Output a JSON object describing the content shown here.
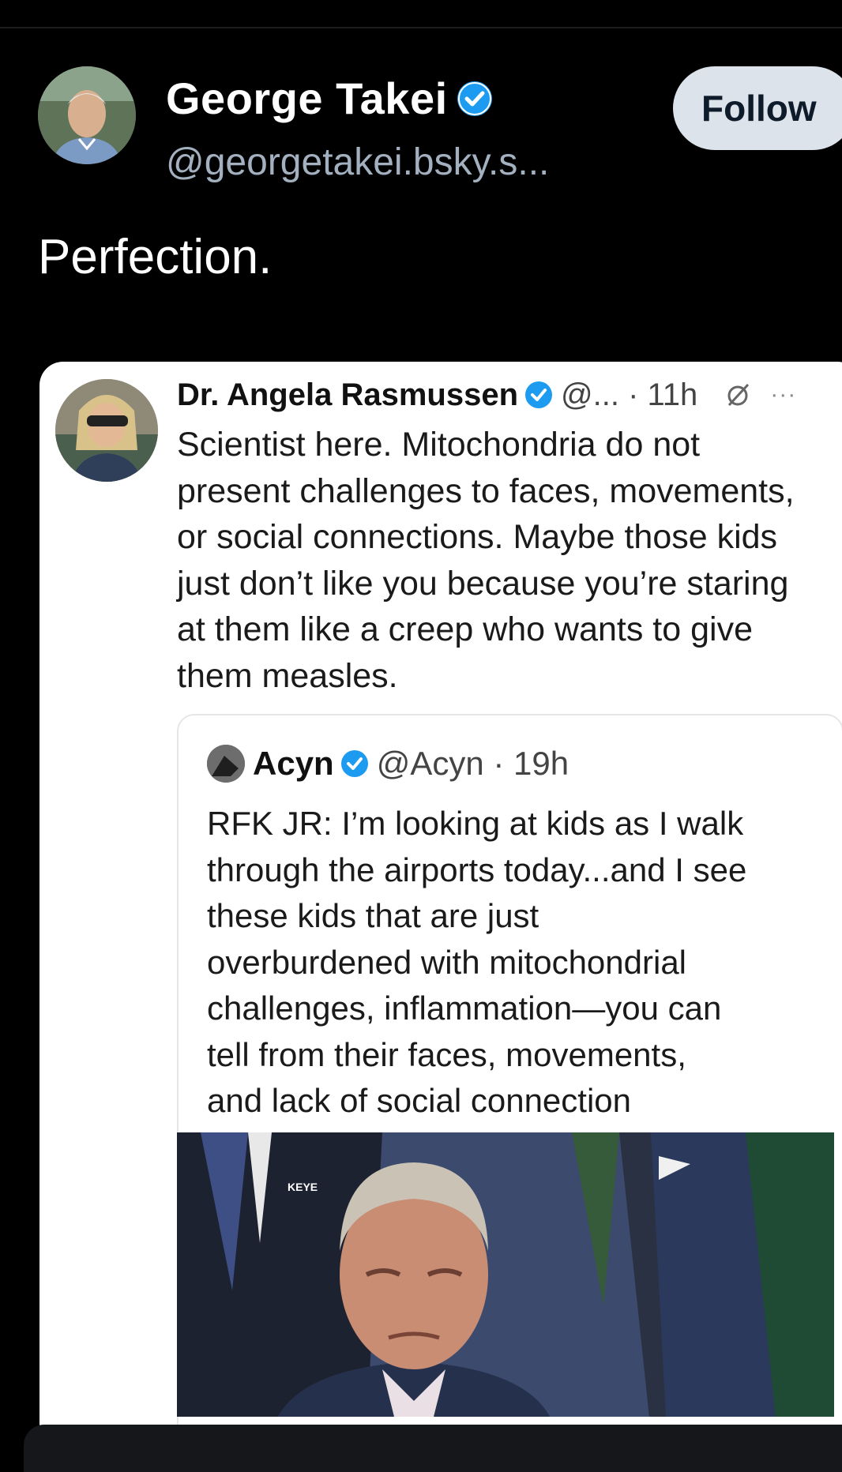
{
  "post": {
    "author_name": "George Takei",
    "author_handle": "@georgetakei.bsky.s...",
    "follow_label": "Follow",
    "text": "Perfection."
  },
  "embed": {
    "author_name": "Dr. Angela Rasmussen",
    "meta": "@... · 11h",
    "more": "···",
    "body": "Scientist here. Mitochondria do not\npresent challenges to faces, movements,\nor social connections. Maybe those kids\njust don’t like you because you’re staring\nat them like a creep who wants to give\nthem measles.",
    "quote": {
      "author_name": "Acyn",
      "meta": "@Acyn · 19h",
      "body": "RFK JR: I’m looking at kids as I walk\nthrough the airports today...and I see\nthese kids that are just\noverburdened with mitochondrial\nchallenges, inflammation—you can\ntell from their faces, movements,\nand lack of social connection",
      "photo_caption": "KEYE"
    }
  },
  "colors": {
    "background": "#000000",
    "handle": "#a3b0c0",
    "follow_bg": "#dde3ea",
    "verified": "#1d9bf0"
  }
}
